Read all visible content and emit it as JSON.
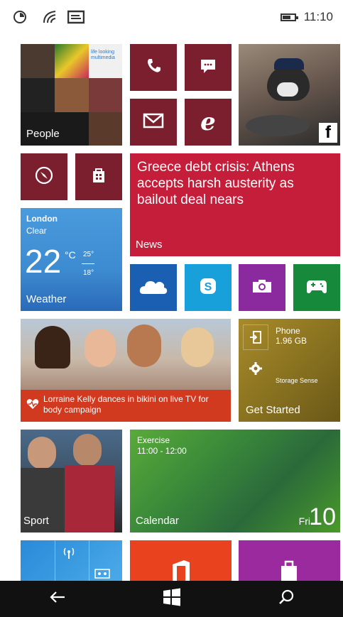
{
  "status_bar": {
    "time": "11:10",
    "battery_level": 0.7
  },
  "tiles": {
    "people": {
      "label": "People",
      "snippet": "life looking\nmultimedia"
    },
    "news": {
      "headline": "Greece debt crisis: Athens accepts harsh austerity as bailout deal nears",
      "label": "News"
    },
    "weather": {
      "city": "London",
      "condition": "Clear",
      "temp": "22",
      "unit": "°C",
      "high": "25°",
      "low": "18°",
      "label": "Weather"
    },
    "lifestyle": {
      "headline": "Lorraine Kelly dances in bikini on live TV for body campaign"
    },
    "storage": {
      "drive": "Phone",
      "size": "1.96 GB",
      "label": "Storage Sense",
      "get_started": "Get Started"
    },
    "sport": {
      "label": "Sport"
    },
    "calendar": {
      "event": "Exercise",
      "time": "11:00 - 12:00",
      "label": "Calendar",
      "day": "Fri",
      "date": "10"
    }
  },
  "icons": {
    "status": [
      "data-sense-icon",
      "wifi-icon",
      "message-icon"
    ],
    "apps": [
      "phone-icon",
      "messaging-icon",
      "mail-icon",
      "internet-explorer-icon",
      "maps-icon",
      "store-icon",
      "onedrive-icon",
      "skype-icon",
      "camera-icon",
      "xbox-icon",
      "facebook-icon",
      "heart-icon",
      "gear-icon",
      "sign-in-icon"
    ],
    "taskbar": [
      "back-icon",
      "windows-start-icon",
      "search-icon"
    ]
  },
  "colors": {
    "maroon": "#7b1e2e",
    "news_red": "#c41e3a",
    "weather_blue": "#3d8bd0",
    "onedrive_blue": "#1b5fb3",
    "skype_blue": "#18a0db",
    "camera_purple": "#8a2a9e",
    "xbox_green": "#168a3a",
    "storage_olive": "#8a7320",
    "lifestyle_red": "#d13a1f",
    "calendar_green": "#3a8a3a",
    "office_orange": "#e8421e",
    "store_purple": "#9a2a9e"
  }
}
